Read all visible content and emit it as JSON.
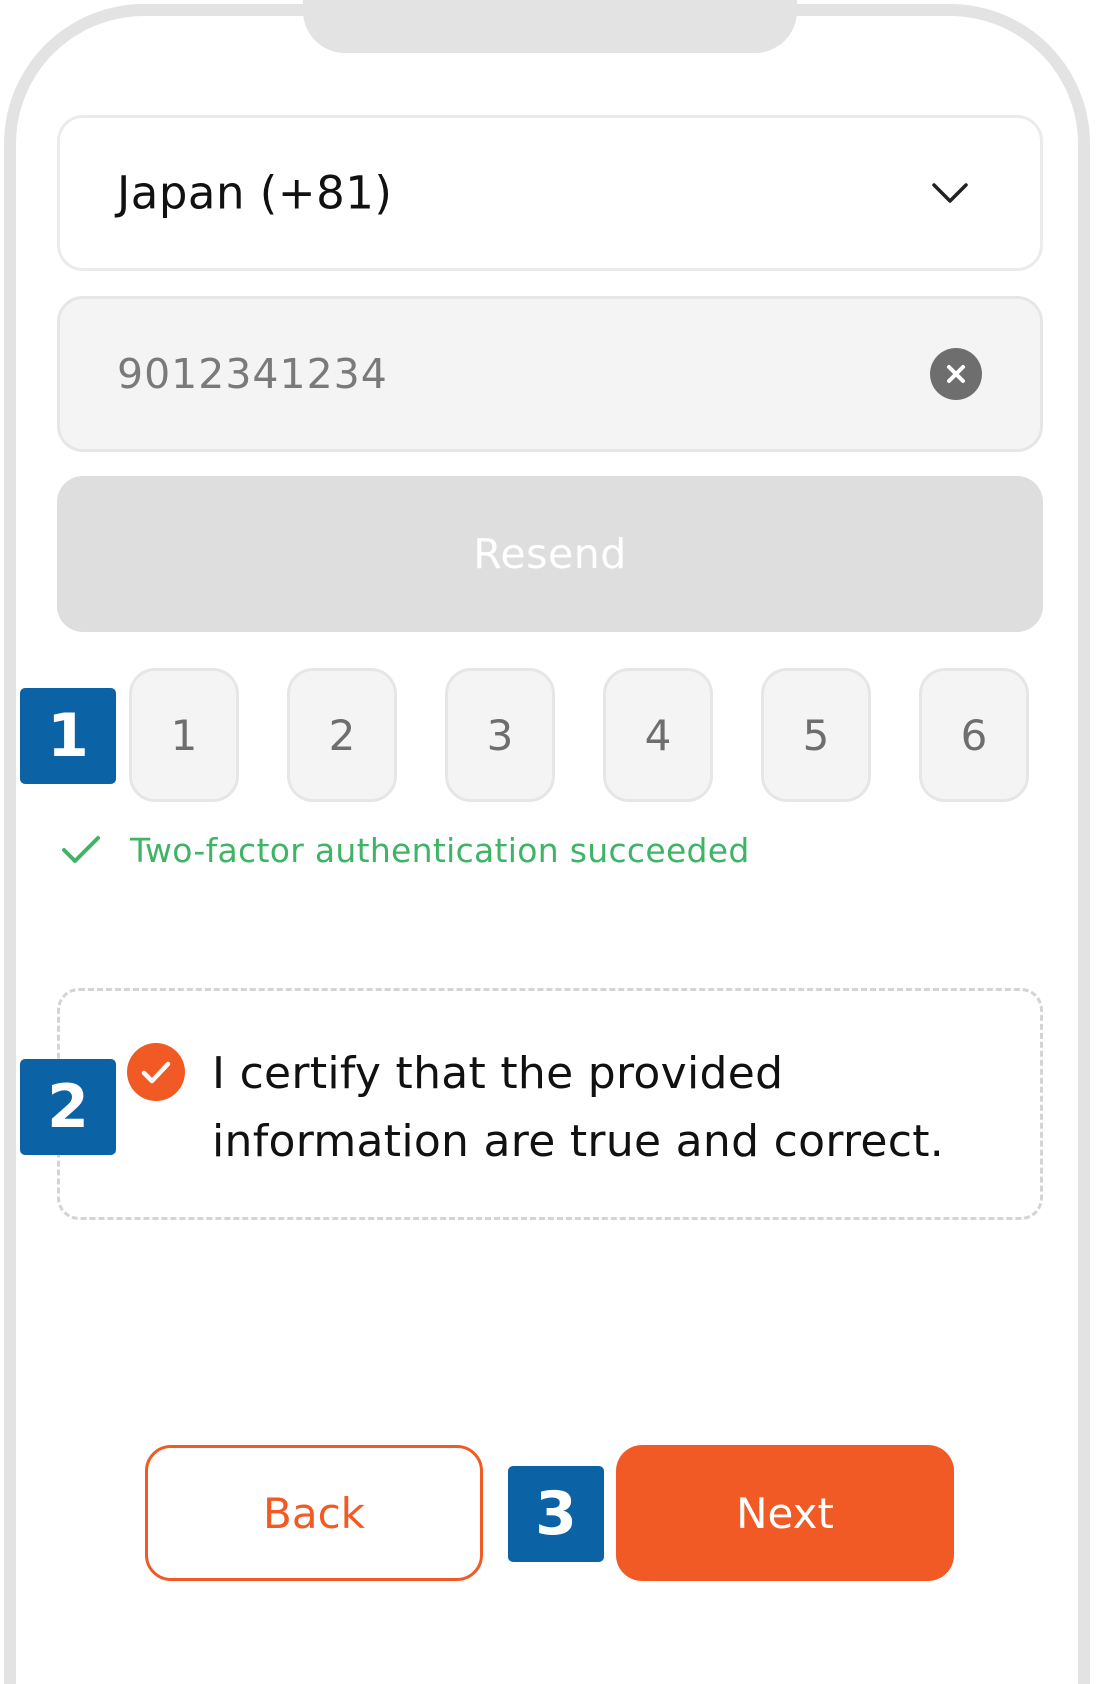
{
  "form": {
    "country_select": {
      "value": "Japan (+81)",
      "icon": "chevron-down-icon"
    },
    "phone_input": {
      "value": "9012341234",
      "clear_icon": "close-icon"
    },
    "resend_button": {
      "label": "Resend"
    },
    "otp_digits": [
      "1",
      "2",
      "3",
      "4",
      "5",
      "6"
    ],
    "status": {
      "icon": "checkmark-icon",
      "text": "Two-factor authentication succeeded",
      "color": "#3fb466"
    },
    "certify": {
      "checked": true,
      "line1": "I certify that the provided",
      "line2": "information are true and correct."
    }
  },
  "actions": {
    "back_label": "Back",
    "next_label": "Next"
  },
  "annotations": {
    "badge_1": "1",
    "badge_2": "2",
    "badge_3": "3"
  },
  "colors": {
    "accent": "#f15a24",
    "badge": "#0b63a6",
    "success": "#3fb466"
  }
}
